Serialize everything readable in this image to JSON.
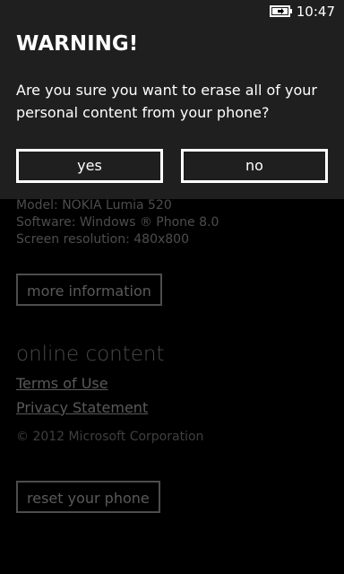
{
  "status_bar": {
    "time": "10:47",
    "battery_icon": "battery-charging-icon"
  },
  "dialog": {
    "title": "WARNING!",
    "message": "Are you sure you want to erase all of your personal content from your phone?",
    "yes_label": "yes",
    "no_label": "no"
  },
  "about": {
    "model": "Model: NOKIA Lumia 520",
    "software": "Software: Windows ® Phone 8.0",
    "screen_resolution": "Screen resolution: 480x800",
    "more_info_label": "more information"
  },
  "online_content": {
    "heading": "online content",
    "terms_link": "Terms of Use",
    "privacy_link": "Privacy Statement",
    "copyright": "© 2012 Microsoft Corporation"
  },
  "reset_button_label": "reset your phone",
  "colors": {
    "dialog_background": "#1f1f1f",
    "background": "#000000",
    "dimmed_text": "#4d4d4d"
  }
}
